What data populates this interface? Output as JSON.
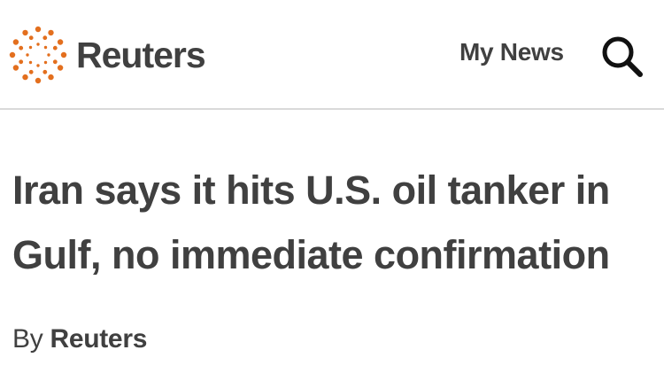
{
  "header": {
    "logo_text": "Reuters",
    "my_news_label": "My News",
    "search_icon": "search-icon",
    "logo_color": "#e36f1e"
  },
  "article": {
    "headline_line1": "Iran says it hits U.S. oil tanker in",
    "headline_line2": "Gulf, no immediate confirmation",
    "byline_prefix": "By",
    "byline_author": "Reuters"
  }
}
